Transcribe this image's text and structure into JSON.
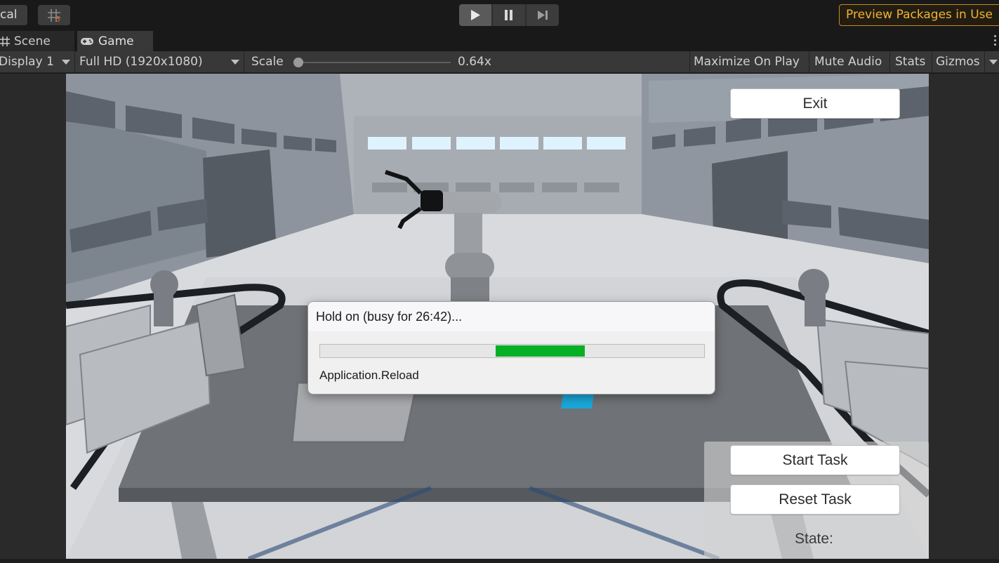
{
  "toolbar": {
    "local_label": "cal",
    "play_mode": "playing",
    "preview_packages_label": "Preview Packages in Use"
  },
  "tabs": [
    {
      "label": "Scene",
      "icon": "grid-icon",
      "active": false
    },
    {
      "label": "Game",
      "icon": "gamepad-icon",
      "active": true
    }
  ],
  "game_bar": {
    "display": "Display 1",
    "resolution": "Full HD (1920x1080)",
    "scale_label": "Scale",
    "scale_value": "0.64x",
    "maximize_on_play": "Maximize On Play",
    "mute_audio": "Mute Audio",
    "stats": "Stats",
    "gizmos": "Gizmos"
  },
  "game_ui": {
    "exit_label": "Exit",
    "start_task_label": "Start Task",
    "reset_task_label": "Reset Task",
    "state_label": "State:"
  },
  "busy_dialog": {
    "title": "Hold on (busy for 26:42)...",
    "status": "Application.Reload",
    "progress_indicator": "indeterminate",
    "progress_color": "#06b025"
  },
  "colors": {
    "accent_warning": "#f2b332",
    "editor_bg": "#191919"
  }
}
